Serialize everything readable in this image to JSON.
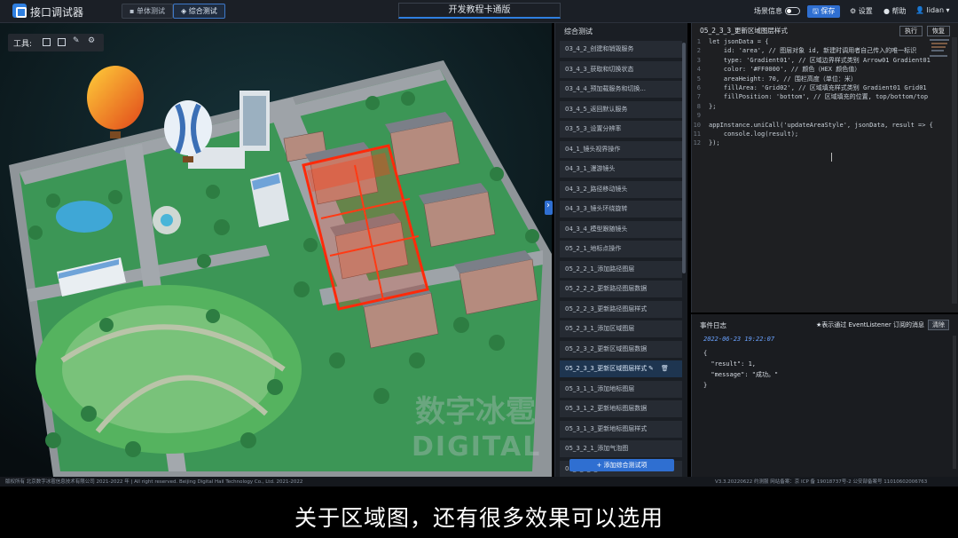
{
  "app": {
    "title": "接口调试器"
  },
  "modes": [
    {
      "label": "单体测试"
    },
    {
      "label": "综合测试"
    }
  ],
  "header": {
    "center_title": "开发教程卡通版",
    "scene_info_label": "场景信息",
    "save_label": "保存",
    "settings_label": "设置",
    "help_label": "帮助",
    "user_name": "lidan"
  },
  "toolbar": {
    "label": "工具:"
  },
  "test_panel": {
    "title": "综合测试",
    "items": [
      "03_4_2_创建和销毁服务",
      "03_4_3_获取和切换状态",
      "03_4_4_预加载服务和切换...",
      "03_4_5_返回默认服务",
      "03_5_3_设置分辨率",
      "04_1_镜头视界操作",
      "04_3_1_漫游镜头",
      "04_3_2_路径移动镜头",
      "04_3_3_镜头环绕旋转",
      "04_3_4_模型跟随镜头",
      "05_2_1_地标点操作",
      "05_2_2_1_添加路径图层",
      "05_2_2_2_更新路径图层数据",
      "05_2_2_3_更新路径图层样式",
      "05_2_3_1_添加区域图层",
      "05_2_3_2_更新区域图层数据",
      "05_2_3_3_更新区域图层样式",
      "05_3_1_1_添加地标图层",
      "05_3_1_2_更新地标图层数据",
      "05_3_1_3_更新地标图层样式",
      "05_3_2_1_添加气泡图",
      "05_3_2_2_更新气泡图数据"
    ],
    "selected_index": 16,
    "add_label": "+ 添加综合测试项"
  },
  "editor": {
    "tab_title": "05_2_3_3_更新区域图层样式",
    "run_label": "执行",
    "restore_label": "恢复",
    "lines": [
      {
        "n": "1",
        "text": "let jsonData = {"
      },
      {
        "n": "2",
        "text": "    id: 'area', // 图层对象 id, 新建时调用者自己传入的唯一标识"
      },
      {
        "n": "3",
        "text": "    type: 'Gradient01', // 区域边界样式类别 Arrow01 Gradient01"
      },
      {
        "n": "4",
        "text": "    color: '#FF0000', // 颜色（HEX 颜色值）"
      },
      {
        "n": "5",
        "text": "    areaHeight: 70, // 围栏高度（单位：米）"
      },
      {
        "n": "6",
        "text": "    fillArea: 'Grid02', // 区域填充样式类别 Gradient01 Grid01"
      },
      {
        "n": "7",
        "text": "    fillPosition: 'bottom', // 区域填充的位置, top/bottom/top"
      },
      {
        "n": "8",
        "text": "};"
      },
      {
        "n": "9",
        "text": ""
      },
      {
        "n": "10",
        "text": "appInstance.uniCall('updateAreaStyle', jsonData, result => {"
      },
      {
        "n": "11",
        "text": "    console.log(result);"
      },
      {
        "n": "12",
        "text": "});"
      }
    ]
  },
  "log": {
    "title": "事件日志",
    "note": "★表示通过 EventListener 订阅的消息",
    "clear_label": "清除",
    "timestamp": "2022-06-23 19:22:07",
    "body": "{\n  \"result\": 1,\n  \"message\": \"成功。\"\n}"
  },
  "footer": {
    "copyright": "版权所有 北京数字冰雹信息技术有限公司 2021-2022 年 | All right reserved. Beijing Digital Hail Technology Co., Ltd. 2021-2022",
    "version": "V3.3.20220622 约测服  网站备案：京 ICP 备 19018737号-2 公安部备案号 11010602006763"
  },
  "watermark": {
    "cn": "数字冰雹",
    "en": "DIGITAL HAIL"
  },
  "subtitle": {
    "text": "关于区域图，还有很多效果可以选用"
  },
  "colors": {
    "accent": "#2f6fd1",
    "area_highlight": "#ff2a0a",
    "grass": "#3fa35a",
    "road": "#9aa0a6"
  }
}
